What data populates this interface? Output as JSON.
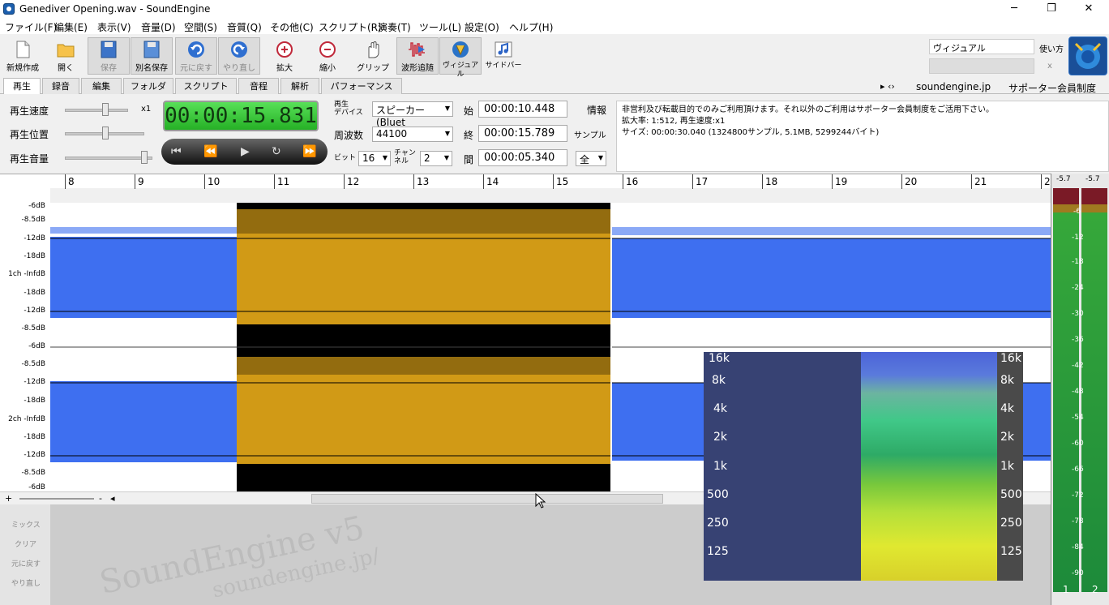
{
  "window": {
    "title": "Genediver Opening.wav - SoundEngine",
    "minimize": "─",
    "maximize": "❐",
    "close": "✕"
  },
  "menu": [
    "ファイル(F)",
    "編集(E)",
    "表示(V)",
    "音量(D)",
    "空間(S)",
    "音質(Q)",
    "その他(C)",
    "スクリプト(R)",
    "演奏(T)",
    "ツール(L)",
    "設定(O)",
    "ヘルプ(H)"
  ],
  "toolbar": {
    "new": "新規作成",
    "open": "開く",
    "save": "保存",
    "save_as": "別名保存",
    "undo": "元に戻す",
    "redo": "やり直し",
    "zoom_in": "拡大",
    "zoom_out": "縮小",
    "grip": "グリップ",
    "follow": "波形追随",
    "visual": "ヴィジュアル",
    "sidebar": "サイドバー"
  },
  "visual_panel": {
    "value": "ヴィジュアル",
    "howto": "使い方",
    "close": "x"
  },
  "tabs": [
    "再生",
    "録音",
    "編集",
    "フォルダ",
    "スクリプト",
    "音程",
    "解析",
    "パフォーマンス"
  ],
  "active_tab": "再生",
  "header_right": {
    "arrows": "▸ ‹›",
    "site": "soundengine.jp",
    "supporter": "サポーター会員制度"
  },
  "play": {
    "speed_label": "再生速度",
    "speed_value": "x1",
    "position_label": "再生位置",
    "volume_label": "再生音量",
    "time": "00:00:15.831",
    "device_label": "再生\nデバイス",
    "device_value": "スピーカー (Bluet",
    "freq_label": "周波数",
    "freq_value": "44100",
    "bit_label": "ビット",
    "bit_value": "16",
    "channel_label": "チャン\nネル",
    "channel_value": "2",
    "start_label": "始",
    "start_value": "00:00:10.448",
    "end_label": "終",
    "end_value": "00:00:15.789",
    "len_label": "間",
    "len_value": "00:00:05.340",
    "unit_label": "サンプル",
    "all_value": "全",
    "info_label": "情報"
  },
  "transport": {
    "first": "⏮",
    "rew": "⏪",
    "play": "▶",
    "loop": "↻",
    "ff": "⏩"
  },
  "info": {
    "line1": "非営利及び転載目的でのみご利用頂けます。それ以外のご利用はサポーター会員制度をご活用下さい。",
    "line2": "拡大率: 1:512, 再生速度:x1",
    "line3": "サイズ: 00:00:30.040 (1324800サンプル, 5.1MB, 5299244バイト)"
  },
  "ruler": [
    "8",
    "9",
    "10",
    "11",
    "12",
    "13",
    "14",
    "15",
    "16",
    "17",
    "18",
    "19",
    "20",
    "21",
    "2"
  ],
  "db_ch1": [
    "-6dB",
    "-8.5dB",
    "-12dB",
    "-18dB",
    "1ch -InfdB",
    "-18dB",
    "-12dB",
    "-8.5dB",
    "-6dB"
  ],
  "db_ch2": [
    "-8.5dB",
    "-12dB",
    "-18dB",
    "2ch -InfdB",
    "-18dB",
    "-12dB",
    "-8.5dB",
    "-6dB"
  ],
  "scroll": {
    "plus": "+",
    "minus": "-",
    "left": "◂"
  },
  "mix": [
    "ミックス",
    "クリア",
    "元に戻す",
    "やり直し"
  ],
  "meters": {
    "peak1": "-5.7",
    "peak2": "-5.7",
    "ticks": [
      "-6",
      "-12",
      "-18",
      "-24",
      "-30",
      "-36",
      "-42",
      "-48",
      "-54",
      "-60",
      "-66",
      "-72",
      "-78",
      "-84",
      "-90"
    ],
    "ch1": "1",
    "ch2": "2"
  },
  "spectrum": {
    "freqs": [
      "16k",
      "8k",
      "4k",
      "2k",
      "1k",
      "500",
      "250",
      "125"
    ]
  },
  "watermark": {
    "brand": "SoundEngine v5",
    "url": "soundengine.jp/"
  },
  "colors": {
    "wave": "#3e6ff0",
    "selected_wave": "#d19a16",
    "selection_bg": "#000000",
    "timer": "#3ccf3c"
  }
}
